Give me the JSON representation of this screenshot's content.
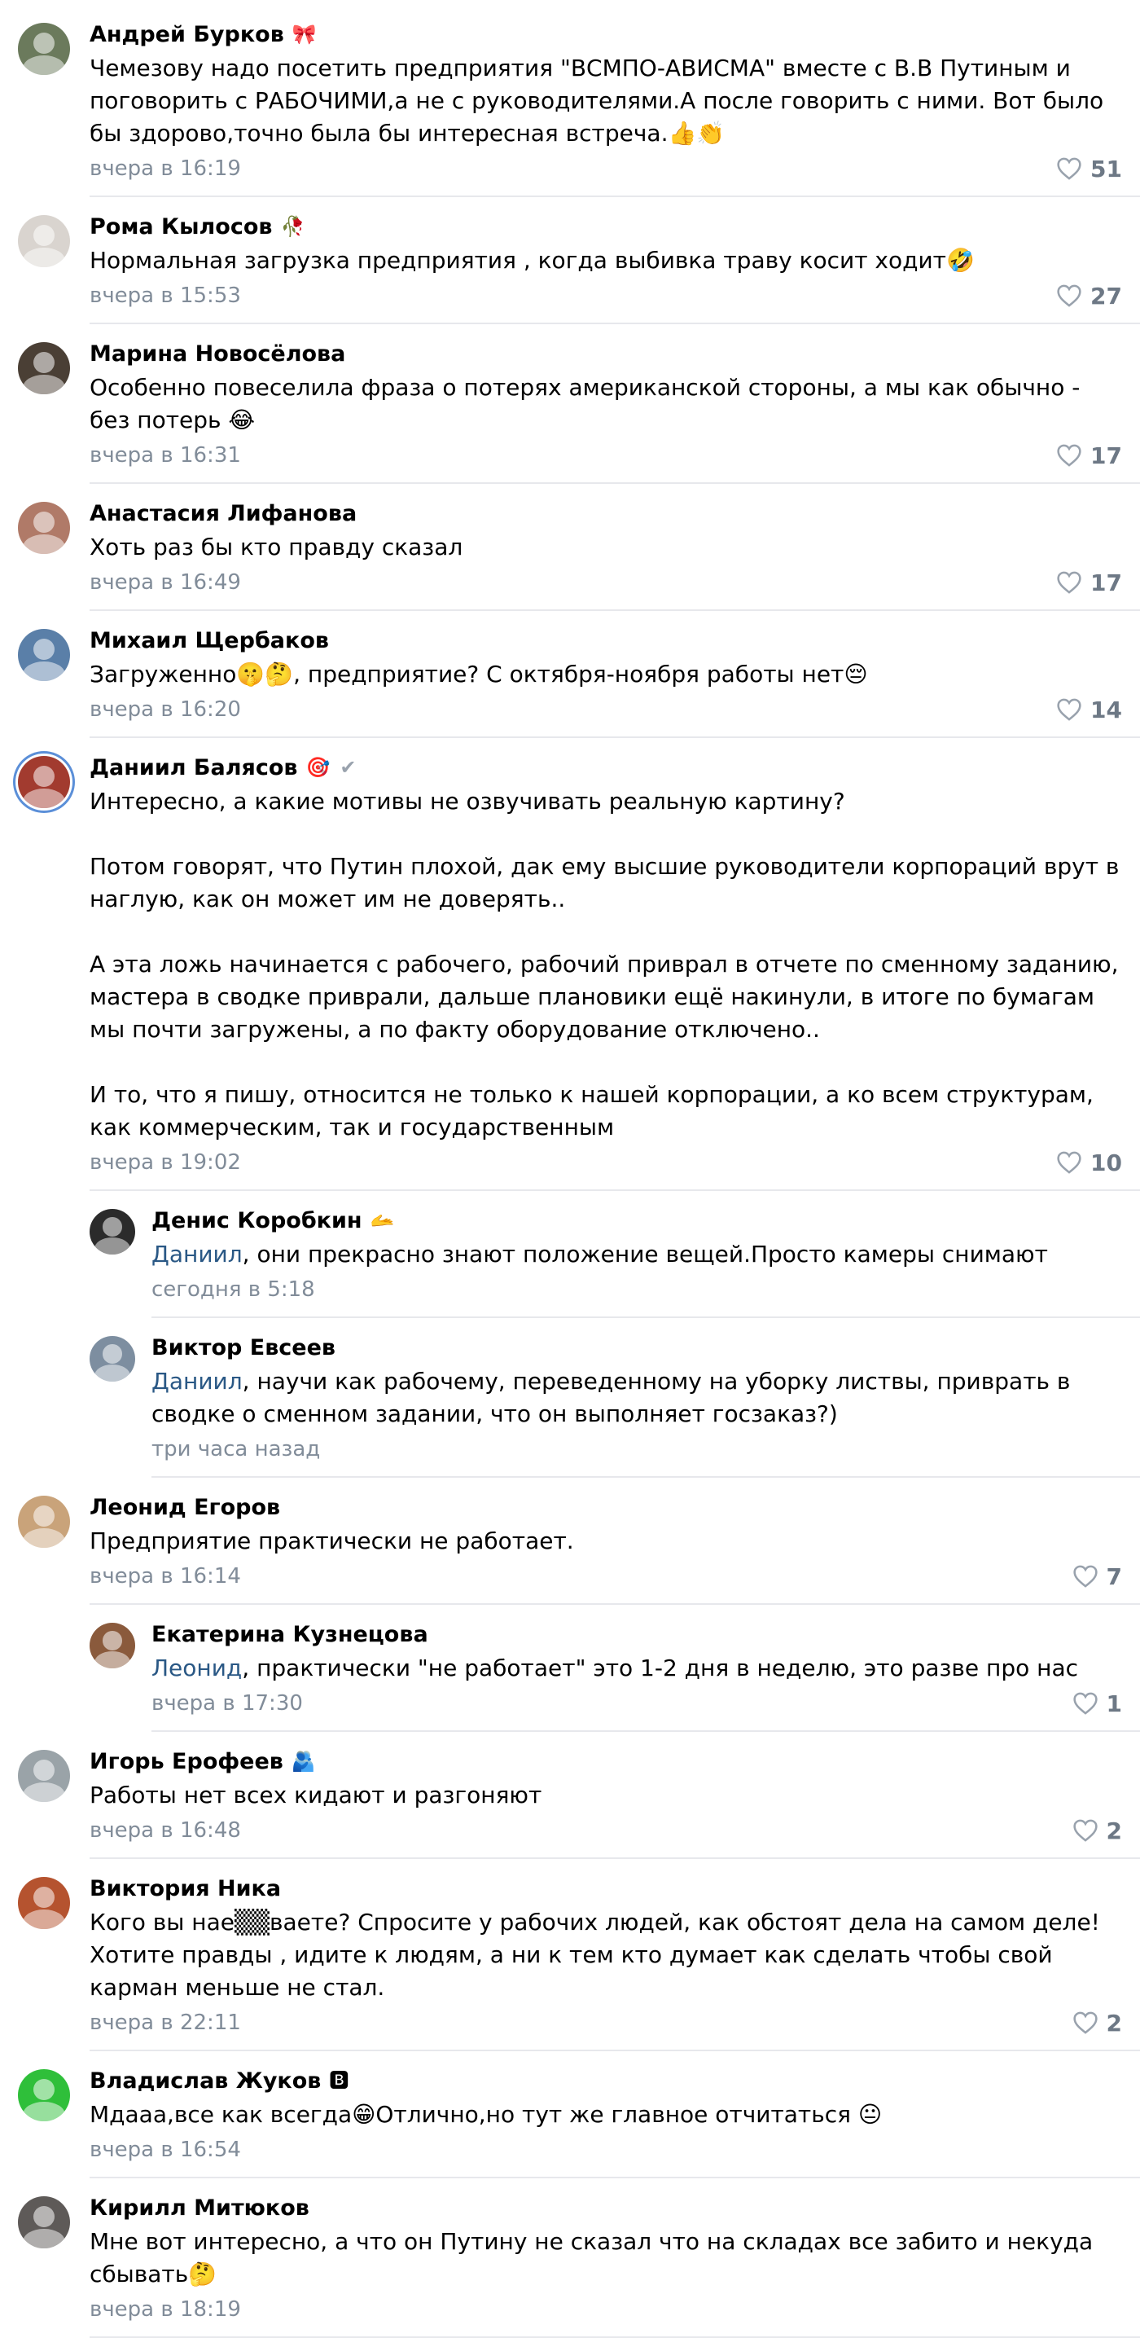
{
  "comments": [
    {
      "author": "Андрей Бурков",
      "badge": "🎀",
      "verified": "",
      "text": "Чемезову надо посетить предприятия \"ВСМПО-АВИСМА\" вместе с В.В Путиным и поговорить с РАБОЧИМИ,а не с руководителями.А после говорить с ними. Вот было бы здорово,точно была бы интересная встреча.👍👏",
      "addressee": "",
      "date": "вчера в 16:19",
      "likes": "51",
      "reply": false,
      "avatar_color": "#6b7a5c"
    },
    {
      "author": "Рома Кылосов",
      "badge": "🥀",
      "verified": "",
      "text": "Нормальная загрузка предприятия , когда выбивка траву косит ходит🤣",
      "addressee": "",
      "date": "вчера в 15:53",
      "likes": "27",
      "reply": false,
      "avatar_color": "#d9d4cf"
    },
    {
      "author": "Марина Новосёлова",
      "badge": "",
      "verified": "",
      "text": "Особенно повеселила фраза о потерях американской стороны, а мы как обычно - без потерь 😂",
      "addressee": "",
      "date": "вчера в 16:31",
      "likes": "17",
      "reply": false,
      "avatar_color": "#4a3f35"
    },
    {
      "author": "Анастасия Лифанова",
      "badge": "",
      "verified": "",
      "text": "Хоть раз бы кто правду сказал",
      "addressee": "",
      "date": "вчера в 16:49",
      "likes": "17",
      "reply": false,
      "avatar_color": "#b07a68"
    },
    {
      "author": "Михаил Щербаков",
      "badge": "",
      "verified": "",
      "text": "Загруженно🤫🤔, предприятие? С октября-ноября работы нет😔",
      "addressee": "",
      "date": "вчера в 16:20",
      "likes": "14",
      "reply": false,
      "avatar_color": "#5a7fa8"
    },
    {
      "author": "Даниил Балясов",
      "badge": "🎯",
      "verified": "✔",
      "text": "Интересно, а какие мотивы не озвучивать реальную картину?\n\nПотом говорят, что Путин плохой, дак ему высшие руководители корпораций врут в наглую, как он может им не доверять..\n\nА эта ложь начинается с рабочего, рабочий приврал в отчете по сменному заданию, мастера в сводке приврали, дальше плановики ещё накинули, в итоге по бумагам мы почти загружены, а по факту оборудование отключено..\n\nИ то, что я пишу, относится не только к нашей корпорации, а ко всем структурам, как коммерческим, так и государственным",
      "addressee": "",
      "date": "вчера в 19:02",
      "likes": "10",
      "reply": false,
      "avatar_color": "#a23b2f",
      "ring": true
    },
    {
      "author": "Денис Коробкин",
      "badge": "🫴",
      "verified": "",
      "addressee": "Даниил",
      "text": ", они прекрасно знают положение вещей.Просто камеры снимают",
      "date": "сегодня в 5:18",
      "likes": "",
      "reply": true,
      "avatar_color": "#2b2b2b"
    },
    {
      "author": "Виктор Евсеев",
      "badge": "",
      "verified": "",
      "addressee": "Даниил",
      "text": ", научи как рабочему, переведенному на уборку листвы, приврать в сводке о сменном задании, что он выполняет госзаказ?)",
      "date": "три часа назад",
      "likes": "",
      "reply": true,
      "avatar_color": "#7d8ea0"
    },
    {
      "author": "Леонид Егоров",
      "badge": "",
      "verified": "",
      "text": "Предприятие практически не работает.",
      "addressee": "",
      "date": "вчера в 16:14",
      "likes": "7",
      "reply": false,
      "avatar_color": "#c9a37a"
    },
    {
      "author": "Екатерина Кузнецова",
      "badge": "",
      "verified": "",
      "addressee": "Леонид",
      "text": ", практически \"не работает\" это 1-2 дня в неделю, это разве про нас",
      "date": "вчера в 17:30",
      "likes": "1",
      "reply": true,
      "avatar_color": "#8a5a3c"
    },
    {
      "author": "Игорь Ерофеев",
      "badge": "🫂",
      "verified": "",
      "text": "Работы нет всех кидают и разгоняют",
      "addressee": "",
      "date": "вчера в 16:48",
      "likes": "2",
      "reply": false,
      "avatar_color": "#9aa3a8"
    },
    {
      "author": "Виктория Ника",
      "badge": "",
      "verified": "",
      "text": "Кого вы нае▒▒ваете? Спросите у рабочих людей, как обстоят дела на самом деле! Хотите правды , идите к людям, а ни к тем кто думает как сделать чтобы свой карман меньше не стал.",
      "addressee": "",
      "date": "вчера в 22:11",
      "likes": "2",
      "reply": false,
      "avatar_color": "#b5532f"
    },
    {
      "author": "Владислав Жуков",
      "badge": "🅱",
      "verified": "",
      "text": "Мдааа,все как всегда😁Отлично,но тут же главное отчитаться 😐",
      "addressee": "",
      "date": "вчера в 16:54",
      "likes": "",
      "reply": false,
      "avatar_color": "#2fbf3a"
    },
    {
      "author": "Кирилл Митюков",
      "badge": "",
      "verified": "",
      "text": "Мне вот интересно, а что он Путину не сказал что на складах все забито и некуда сбывать🤔",
      "addressee": "",
      "date": "вчера в 18:19",
      "likes": "",
      "reply": false,
      "avatar_color": "#5e5a58"
    }
  ]
}
